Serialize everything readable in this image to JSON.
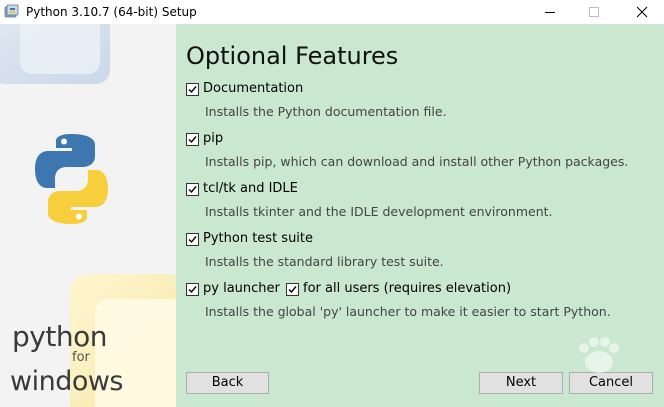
{
  "window": {
    "title": "Python 3.10.7 (64-bit) Setup",
    "controls": [
      "minimize-icon",
      "maximize-icon",
      "close-icon"
    ]
  },
  "banner": {
    "logo": "python-logo",
    "word_python": "python",
    "word_for": "for",
    "word_windows": "windows"
  },
  "page": {
    "heading": "Optional Features"
  },
  "features": [
    {
      "label": "Documentation",
      "checked": true,
      "description": "Installs the Python documentation file."
    },
    {
      "label": "pip",
      "checked": true,
      "description": "Installs pip, which can download and install other Python packages."
    },
    {
      "label": "tcl/tk and IDLE",
      "checked": true,
      "description": "Installs tkinter and the IDLE development environment."
    },
    {
      "label": "Python test suite",
      "checked": true,
      "description": "Installs the standard library test suite."
    },
    {
      "label": "py launcher",
      "checked": true,
      "description": "Installs the global 'py' launcher to make it easier to start Python."
    }
  ],
  "extra_option": {
    "label": "for all users (requires elevation)",
    "checked": true
  },
  "buttons": {
    "back": "Back",
    "next": "Next",
    "cancel": "Cancel"
  },
  "colors": {
    "panel_bg": "#c9e8cf",
    "python_blue": "#3d77b0",
    "python_yellow": "#f7cf3d"
  }
}
